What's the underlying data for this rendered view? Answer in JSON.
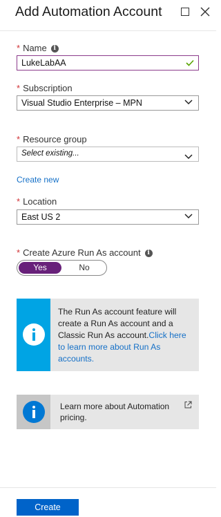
{
  "header": {
    "title": "Add Automation Account"
  },
  "form": {
    "name": {
      "required": "*",
      "label": "Name",
      "value": "LukeLabAA"
    },
    "subscription": {
      "required": "*",
      "label": "Subscription",
      "value": "Visual Studio Enterprise – MPN"
    },
    "resource_group": {
      "required": "*",
      "label": "Resource group",
      "placeholder": "Select existing...",
      "create_new_link": "Create new"
    },
    "location": {
      "required": "*",
      "label": "Location",
      "value": "East US 2"
    },
    "run_as": {
      "required": "*",
      "label": "Create Azure Run As account",
      "yes_label": "Yes",
      "no_label": "No",
      "selected": "Yes"
    }
  },
  "info_runas": {
    "text": "The Run As account feature will create a Run As account and a Classic Run As account.",
    "link": "Click here to learn more about Run As accounts.",
    "accent_color": "#00a4e4"
  },
  "info_pricing": {
    "text": "Learn more about Automation pricing.",
    "accent_color": "#0078d4"
  },
  "footer": {
    "create_label": "Create"
  },
  "colors": {
    "toggle_active": "#68217a",
    "primary_button": "#0063c9",
    "required": "#d13438",
    "link": "#1570c7",
    "valid_check": "#57a300"
  }
}
